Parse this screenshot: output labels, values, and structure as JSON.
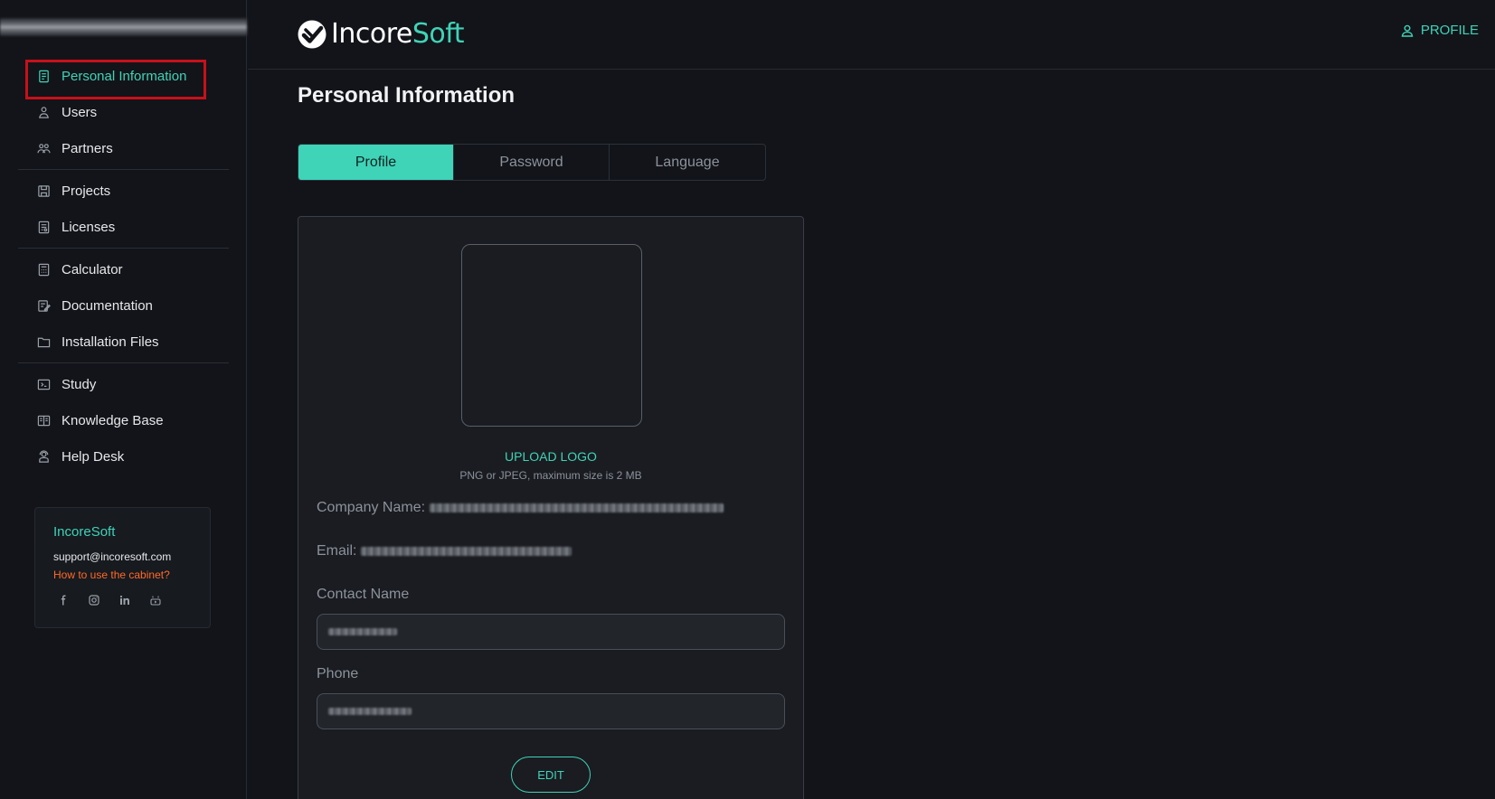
{
  "app": {
    "logo_part1": "Incore",
    "logo_part2": "Soft",
    "profile_label": "PROFILE"
  },
  "sidebar": {
    "groups": [
      [
        {
          "label": "Personal Information",
          "icon": "personal-info-icon",
          "active": true
        },
        {
          "label": "Users",
          "icon": "users-icon"
        },
        {
          "label": "Partners",
          "icon": "partners-icon"
        }
      ],
      [
        {
          "label": "Projects",
          "icon": "projects-icon"
        },
        {
          "label": "Licenses",
          "icon": "licenses-icon"
        }
      ],
      [
        {
          "label": "Calculator",
          "icon": "calculator-icon"
        },
        {
          "label": "Documentation",
          "icon": "documentation-icon"
        },
        {
          "label": "Installation Files",
          "icon": "folder-icon"
        }
      ],
      [
        {
          "label": "Study",
          "icon": "study-icon"
        },
        {
          "label": "Knowledge Base",
          "icon": "knowledge-base-icon"
        },
        {
          "label": "Help Desk",
          "icon": "help-desk-icon"
        }
      ]
    ],
    "contact": {
      "title": "IncoreSoft",
      "email": "support@incoresoft.com",
      "help_link": "How to use the cabinet?",
      "socials": [
        "facebook-icon",
        "instagram-icon",
        "linkedin-icon",
        "youtube-icon"
      ]
    }
  },
  "main": {
    "title": "Personal Information",
    "tabs": [
      {
        "label": "Profile",
        "active": true
      },
      {
        "label": "Password"
      },
      {
        "label": "Language"
      }
    ],
    "form": {
      "upload_label": "UPLOAD LOGO",
      "upload_hint": "PNG or JPEG, maximum size is 2 MB",
      "company_label": "Company Name:",
      "email_label": "Email:",
      "contact_name_label": "Contact Name",
      "phone_label": "Phone",
      "edit_label": "EDIT"
    }
  },
  "colors": {
    "accent": "#3fd3b8",
    "background": "#121419",
    "highlight": "#c8101a",
    "link_orange": "#ff6a2a"
  }
}
